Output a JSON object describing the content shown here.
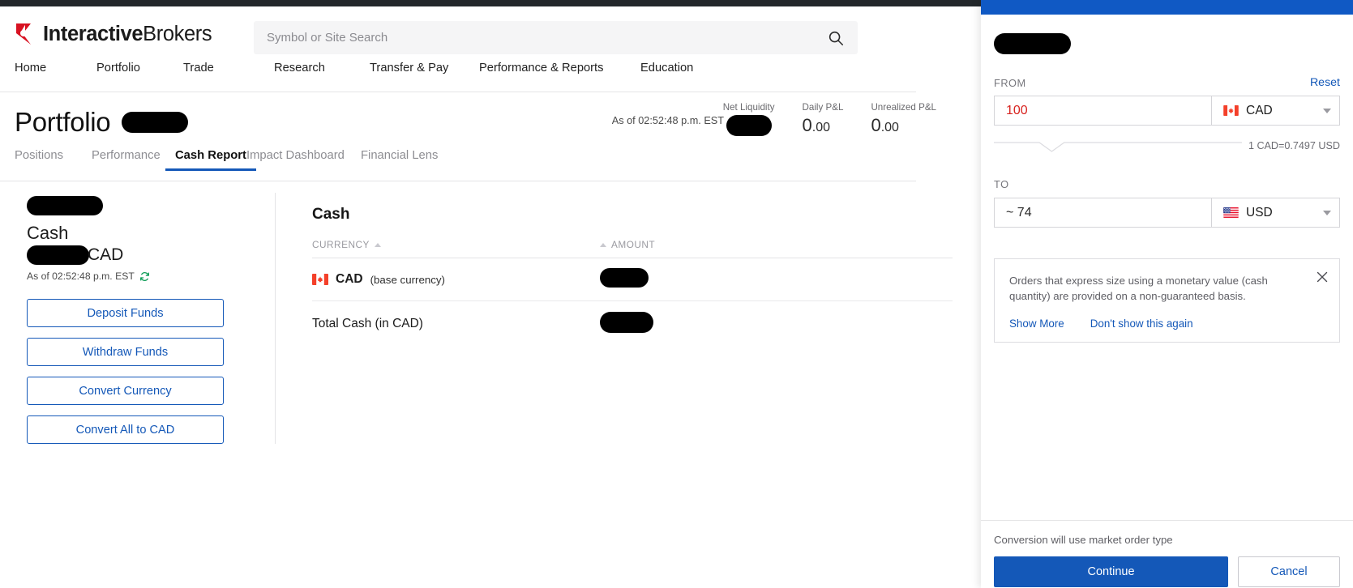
{
  "brand": {
    "name_bold": "Interactive",
    "name_regular": "Brokers"
  },
  "search": {
    "placeholder": "Symbol or Site Search",
    "icon": "search-icon"
  },
  "main_nav": [
    {
      "label": "Home"
    },
    {
      "label": "Portfolio"
    },
    {
      "label": "Trade"
    },
    {
      "label": "Research"
    },
    {
      "label": "Transfer & Pay"
    },
    {
      "label": "Performance & Reports"
    },
    {
      "label": "Education"
    }
  ],
  "page": {
    "title": "Portfolio",
    "as_of": "As of 02:52:48 p.m. EST",
    "refresh_icon": "refresh-icon"
  },
  "metrics": [
    {
      "label": "Net Liquidity",
      "value": "",
      "redacted": true
    },
    {
      "label": "Daily P&L",
      "value": "0",
      "decimals": ".00"
    },
    {
      "label": "Unrealized P&L",
      "value": "0",
      "decimals": ".00"
    }
  ],
  "tabs": [
    {
      "label": "Positions",
      "active": false
    },
    {
      "label": "Performance",
      "active": false
    },
    {
      "label": "Cash Report",
      "active": true
    },
    {
      "label": "Impact Dashboard",
      "active": false
    },
    {
      "label": "Financial Lens",
      "active": false
    }
  ],
  "sidebar": {
    "account_redacted": true,
    "heading": "Cash",
    "balance_redacted": true,
    "currency": "CAD",
    "as_of": "As of 02:52:48 p.m. EST",
    "buttons": [
      {
        "label": "Deposit Funds"
      },
      {
        "label": "Withdraw Funds"
      },
      {
        "label": "Convert Currency"
      },
      {
        "label": "Convert All to CAD"
      }
    ]
  },
  "cash_table": {
    "heading": "Cash",
    "columns": [
      {
        "label": "CURRENCY",
        "sort": "asc"
      },
      {
        "label": "AMOUNT",
        "sort": "asc"
      }
    ],
    "rows": [
      {
        "currency_code": "CAD",
        "currency_note": "(base currency)",
        "flag": "flag-canada",
        "amount_redacted": true
      }
    ],
    "total_label": "Total Cash (in CAD)",
    "total_redacted": true
  },
  "convert_panel": {
    "title_redacted": true,
    "from_label": "FROM",
    "reset_label": "Reset",
    "from_amount": "100",
    "from_currency": "CAD",
    "from_flag": "flag-canada",
    "rate_text": "1 CAD=0.7497 USD",
    "to_label": "TO",
    "to_amount": "~ 74",
    "to_currency": "USD",
    "to_flag": "flag-usa",
    "notice": {
      "text": "Orders that express size using a monetary value (cash quantity) are provided on a non-guaranteed basis.",
      "show_more": "Show More",
      "dont_show": "Don't show this again",
      "close_icon": "close-icon"
    },
    "footer_note": "Conversion will use market order type",
    "primary_button": "Continue",
    "secondary_button": "Cancel"
  },
  "colors": {
    "brand_red": "#d81222",
    "accent_blue": "#1458b8",
    "panel_header_blue": "#1059c4",
    "amount_red": "#d8231f",
    "dark_strip": "#23272b"
  }
}
